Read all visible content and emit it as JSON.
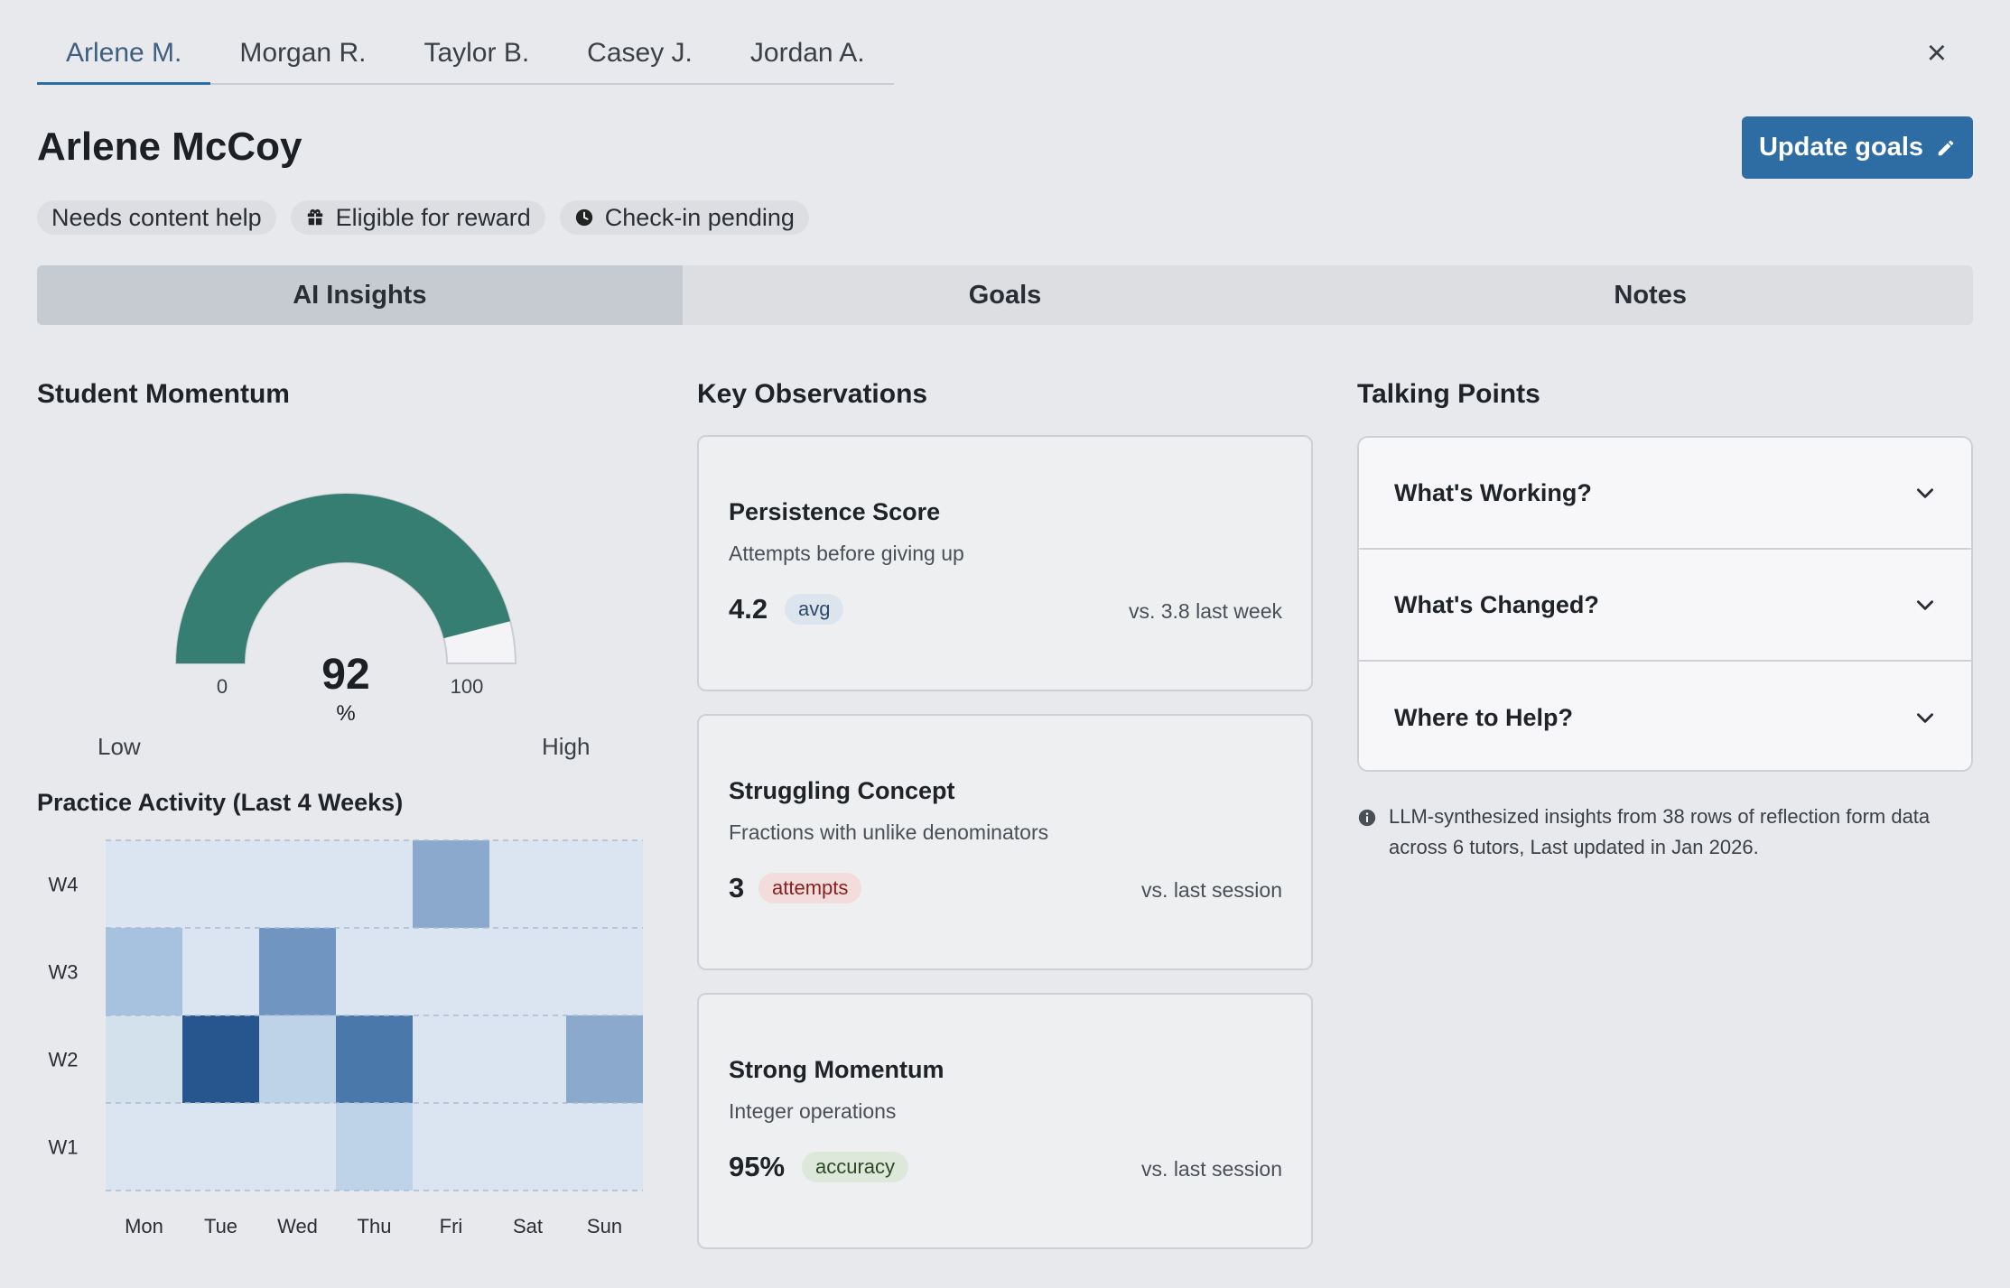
{
  "top_tabs": [
    "Arlene M.",
    "Morgan R.",
    "Taylor B.",
    "Casey J.",
    "Jordan A."
  ],
  "close_label": "×",
  "student": {
    "name": "Arlene McCoy"
  },
  "update_button": {
    "label": "Update goals"
  },
  "badges": [
    {
      "label": "Needs content help",
      "icon": ""
    },
    {
      "label": "Eligible for reward",
      "icon": "gift-icon"
    },
    {
      "label": "Check-in pending",
      "icon": "clock-icon"
    }
  ],
  "section_tabs": [
    "AI Insights",
    "Goals",
    "Notes"
  ],
  "momentum": {
    "title": "Student Momentum",
    "value": 92,
    "unit": "%",
    "min_label": "0",
    "max_label": "100",
    "low_label": "Low",
    "high_label": "High",
    "color": "#377e72"
  },
  "heatmap": {
    "title": "Practice Activity (Last 4 Weeks)",
    "rows": [
      "W4",
      "W3",
      "W2",
      "W1"
    ],
    "cols": [
      "Mon",
      "Tue",
      "Wed",
      "Thu",
      "Fri",
      "Sat",
      "Sun"
    ],
    "levels": [
      [
        1,
        1,
        1,
        1,
        5,
        1,
        1
      ],
      [
        4,
        1,
        6,
        1,
        1,
        1,
        1
      ],
      [
        2,
        9,
        3,
        7,
        1,
        1,
        5
      ],
      [
        1,
        1,
        1,
        3,
        1,
        1,
        1
      ]
    ]
  },
  "observations": {
    "title": "Key Observations",
    "cards": [
      {
        "title": "Persistence Score",
        "subtitle": "Attempts before giving up",
        "value": "4.2",
        "pill": "avg",
        "comparison": "vs. 3.8 last week"
      },
      {
        "title": "Struggling Concept",
        "subtitle": "Fractions with unlike denominators",
        "value": "3",
        "pill": "attempts",
        "comparison": "vs. last session"
      },
      {
        "title": "Strong Momentum",
        "subtitle": "Integer operations",
        "value": "95%",
        "pill": "accuracy",
        "comparison": "vs. last session"
      }
    ]
  },
  "talking_points": {
    "title": "Talking Points",
    "items": [
      "What's Working?",
      "What's Changed?",
      "Where to Help?"
    ],
    "note": "LLM-synthesized insights from 38 rows of reflection form data across 6 tutors, Last updated in Jan 2026."
  }
}
